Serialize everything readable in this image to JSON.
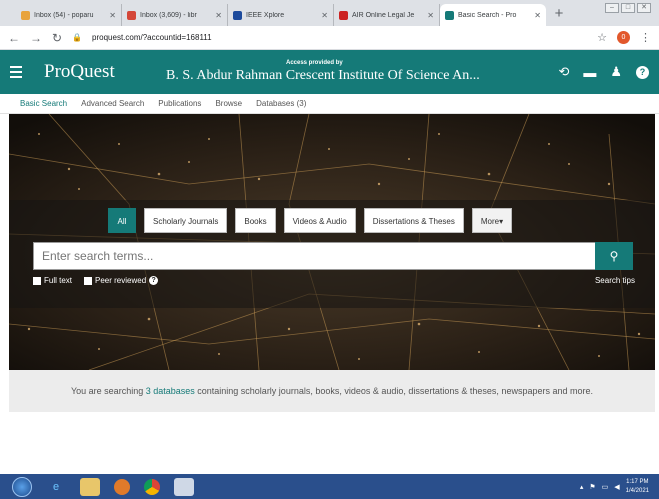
{
  "browser": {
    "tabs": [
      {
        "title": "Inbox (54) - poparu",
        "icon_color": "#e8a33c"
      },
      {
        "title": "Inbox (3,609) - libr",
        "icon_color": "#d44638"
      },
      {
        "title": "IEEE Xplore",
        "icon_color": "#1c4a9c"
      },
      {
        "title": "AIR Online Legal Je",
        "icon_color": "#c22"
      },
      {
        "title": "Basic Search - Pro",
        "icon_color": "#157a78"
      }
    ],
    "new_tab": "+",
    "url": "proquest.com/?accountid=168111",
    "profile_initial": "0"
  },
  "header": {
    "logo": "ProQuest",
    "access_label": "Access provided by",
    "institution": "B. S. Abdur Rahman Crescent Institute Of Science An..."
  },
  "subnav": {
    "items": [
      "Basic Search",
      "Advanced Search",
      "Publications",
      "Browse",
      "Databases (3)"
    ]
  },
  "search": {
    "source_types": [
      "All",
      "Scholarly Journals",
      "Books",
      "Videos & Audio",
      "Dissertations & Theses",
      "More"
    ],
    "placeholder": "Enter search terms...",
    "full_text_label": "Full text",
    "peer_reviewed_label": "Peer reviewed",
    "search_tips": "Search tips"
  },
  "info": {
    "prefix": "You are searching ",
    "link": "3 databases",
    "suffix": " containing scholarly journals, books, videos & audio, dissertations & theses, newspapers and more."
  },
  "taskbar": {
    "time": "1:17 PM",
    "date": "1/4/2021"
  }
}
